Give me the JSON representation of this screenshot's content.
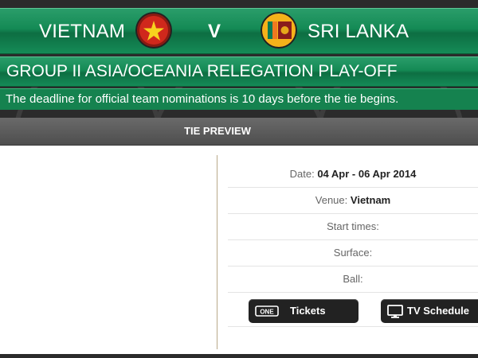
{
  "match": {
    "home_team": "VIETNAM",
    "versus": "V",
    "away_team": "SRI LANKA",
    "home_flag_icon": "vietnam-flag-icon",
    "away_flag_icon": "sri-lanka-flag-icon"
  },
  "group_title": "GROUP II ASIA/OCEANIA RELEGATION PLAY-OFF",
  "notice": "The deadline for official team nominations is 10 days before the tie begins.",
  "preview": {
    "title": "TIE PREVIEW",
    "date_label": "Date:",
    "date_value": "04 Apr - 06 Apr 2014",
    "venue_label": "Venue:",
    "venue_value": "Vietnam",
    "start_times_label": "Start times:",
    "surface_label": "Surface:",
    "ball_label": "Ball:"
  },
  "buttons": {
    "tickets_label": "Tickets",
    "tickets_icon": "ticket-icon",
    "tickets_icon_text": "ONE",
    "tv_label": "TV Schedule",
    "tv_icon": "tv-icon"
  },
  "colors": {
    "green_bar": "#148a55",
    "dark_bg": "#2b2b2b",
    "header_gray": "#5c5c5c",
    "button_bg": "#222222"
  }
}
